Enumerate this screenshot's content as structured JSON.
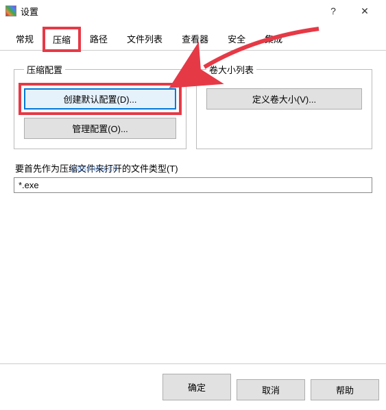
{
  "window": {
    "title": "设置"
  },
  "tabs": [
    "常规",
    "压缩",
    "路径",
    "文件列表",
    "查看器",
    "安全",
    "集成"
  ],
  "active_tab_index": 1,
  "compress_profile": {
    "legend": "压缩配置",
    "create_default": "创建默认配置(D)...",
    "manage": "管理配置(O)..."
  },
  "volume_list": {
    "legend": "卷大小列表",
    "define": "定义卷大小(V)..."
  },
  "filetype": {
    "label": "要首先作为压缩文件来打开的文件类型(T)",
    "value": "*.exe"
  },
  "footer": {
    "ok": "确定",
    "cancel": "取消",
    "help": "帮助"
  },
  "watermark": "passneo.cn"
}
